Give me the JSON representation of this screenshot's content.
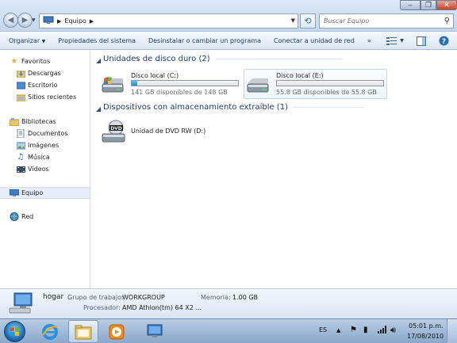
{
  "address": {
    "location": "Equipo",
    "search_placeholder": "Buscar Equipo"
  },
  "toolbar": {
    "organize": "Organizar",
    "system_properties": "Propiedades del sistema",
    "uninstall": "Desinstalar o cambiar un programa",
    "map_drive": "Conectar a unidad de red",
    "more": "»"
  },
  "nav": {
    "favorites": "Favoritos",
    "downloads": "Descargas",
    "desktop": "Escritorio",
    "recent": "Sitios recientes",
    "libraries": "Bibliotecas",
    "documents": "Documentos",
    "images": "Imágenes",
    "music": "Música",
    "videos": "Vídeos",
    "computer": "Equipo",
    "network": "Red"
  },
  "groups": {
    "hard_disks": "Unidades de disco duro (2)",
    "removable": "Dispositivos con almacenamiento extraíble (1)"
  },
  "drives": [
    {
      "name": "Disco local (C:)",
      "free": "141 GB disponibles de 148 GB",
      "used_fraction": 0.05
    },
    {
      "name": "Disco local (E:)",
      "free": "55.8 GB disponibles de 55.8 GB",
      "used_fraction": 0.0
    }
  ],
  "dvd": {
    "name": "Unidad de DVD RW (D:)",
    "icon_text": "DVD"
  },
  "details": {
    "computer_name": "hogar",
    "workgroup_label": "Grupo de trabajo:",
    "workgroup": "WORKGROUP",
    "memory_label": "Memoria:",
    "memory": "1.00 GB",
    "processor_label": "Procesador:",
    "processor": "AMD Athlon(tm) 64 X2 ..."
  },
  "tray": {
    "language": "ES",
    "time": "05:01 p.m.",
    "date": "17/08/2010"
  },
  "colors": {
    "accent": "#1e3d72",
    "drive_fill": "#2787c8"
  }
}
